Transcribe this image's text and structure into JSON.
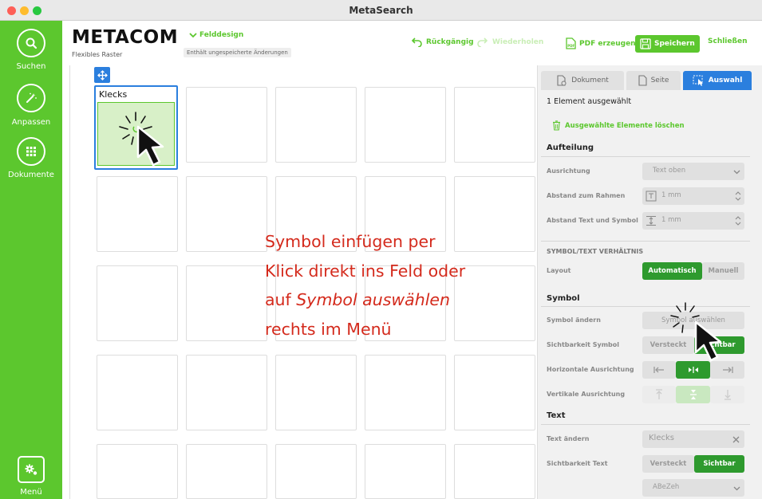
{
  "window": {
    "title": "MetaSearch"
  },
  "sidebar": {
    "items": [
      {
        "label": "Suchen",
        "icon": "search-icon"
      },
      {
        "label": "Anpassen",
        "icon": "magic-wand-icon"
      },
      {
        "label": "Dokumente",
        "icon": "grid-icon"
      }
    ],
    "menu": {
      "label": "Menü",
      "icon": "gears-icon"
    }
  },
  "header": {
    "brand": "METACOM",
    "subtitle": "Flexibles Raster",
    "doc_type": "Felddesign",
    "unsaved": "Enthält ungespeicherte Änderungen",
    "undo": "Rückgängig",
    "redo": "Wiederholen",
    "pdf": "PDF erzeugen",
    "save": "Speichern",
    "close": "Schließen"
  },
  "grid": {
    "selected_cell_label": "Klecks",
    "annotation": {
      "line1": "Symbol einfügen per",
      "line2": "Klick direkt ins Feld oder",
      "line3_prefix": "auf ",
      "line3_italic": "Symbol auswählen",
      "line4": "rechts im Menü"
    }
  },
  "panel": {
    "tabs": {
      "document": "Dokument",
      "page": "Seite",
      "selection": "Auswahl"
    },
    "selected_count": "1 Element ausgewählt",
    "delete": "Ausgewählte Elemente löschen",
    "aufteilung": {
      "heading": "Aufteilung",
      "alignment_label": "Ausrichtung",
      "alignment_value": "Text oben",
      "frame_label": "Abstand zum Rahmen",
      "frame_value": "1 mm",
      "textsym_label": "Abstand Text und Symbol",
      "textsym_value": "1 mm"
    },
    "ratio": {
      "heading": "SYMBOL/TEXT VERHÄLTNIS",
      "layout_label": "Layout",
      "auto": "Automatisch",
      "manual": "Manuell"
    },
    "symbol": {
      "heading": "Symbol",
      "change_label": "Symbol ändern",
      "choose": "Symbol auswählen",
      "visibility_label": "Sichtbarkeit Symbol",
      "hidden": "Versteckt",
      "visible": "Sichtbar",
      "halign_label": "Horizontale Ausrichtung",
      "valign_label": "Vertikale Ausrichtung"
    },
    "text": {
      "heading": "Text",
      "change_label": "Text ändern",
      "value": "Klecks",
      "visibility_label": "Sichtbarkeit Text",
      "hidden": "Versteckt",
      "visible": "Sichtbar",
      "font": "ABeZeh"
    }
  },
  "colors": {
    "accent": "#5cc72e",
    "selection": "#2b7fde",
    "annotation": "#d42a1c",
    "active_segment": "#2e9a2e"
  }
}
